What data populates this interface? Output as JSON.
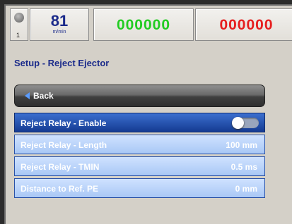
{
  "header": {
    "station_number": "1",
    "speed_value": "81",
    "speed_unit": "m/min",
    "good_count": "000000",
    "reject_count": "000000"
  },
  "page": {
    "title": "Setup - Reject Ejector"
  },
  "back_button": {
    "label": "Back"
  },
  "settings": [
    {
      "label": "Reject Relay - Enable",
      "value": ""
    },
    {
      "label": "Reject Relay - Length",
      "value": "100 mm"
    },
    {
      "label": "Reject Relay - TMIN",
      "value": "0.5 ms"
    },
    {
      "label": "Distance to Ref. PE",
      "value": "0 mm"
    }
  ],
  "colors": {
    "good_counter": "#22cc22",
    "reject_counter": "#e61e1e",
    "accent": "#1a2a8a"
  },
  "icons": {
    "station": "station-indicator-icon",
    "back": "back-arrow-icon"
  }
}
